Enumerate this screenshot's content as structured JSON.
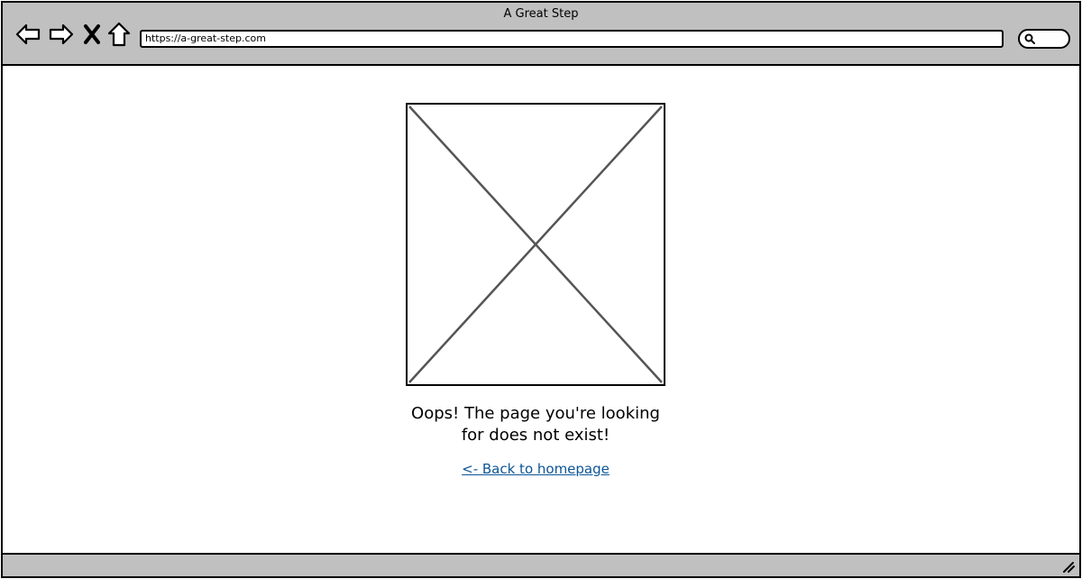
{
  "window": {
    "title": "A Great Step",
    "url": "https://a-great-step.com"
  },
  "toolbar": {
    "buttons": [
      {
        "name": "back-button",
        "icon": "arrow-left-icon"
      },
      {
        "name": "forward-button",
        "icon": "arrow-right-icon"
      },
      {
        "name": "stop-button",
        "icon": "close-icon"
      },
      {
        "name": "home-button",
        "icon": "home-icon"
      }
    ],
    "search_icon": "search-icon"
  },
  "content": {
    "image_icon": "image-placeholder-icon",
    "message": "Oops! The page you're looking for does not exist!",
    "back_link": "<- Back to homepage"
  },
  "colors": {
    "chrome": "#c0c0c0",
    "link": "#0d5596",
    "border": "#000000",
    "placeholder_lines": "#555555"
  }
}
